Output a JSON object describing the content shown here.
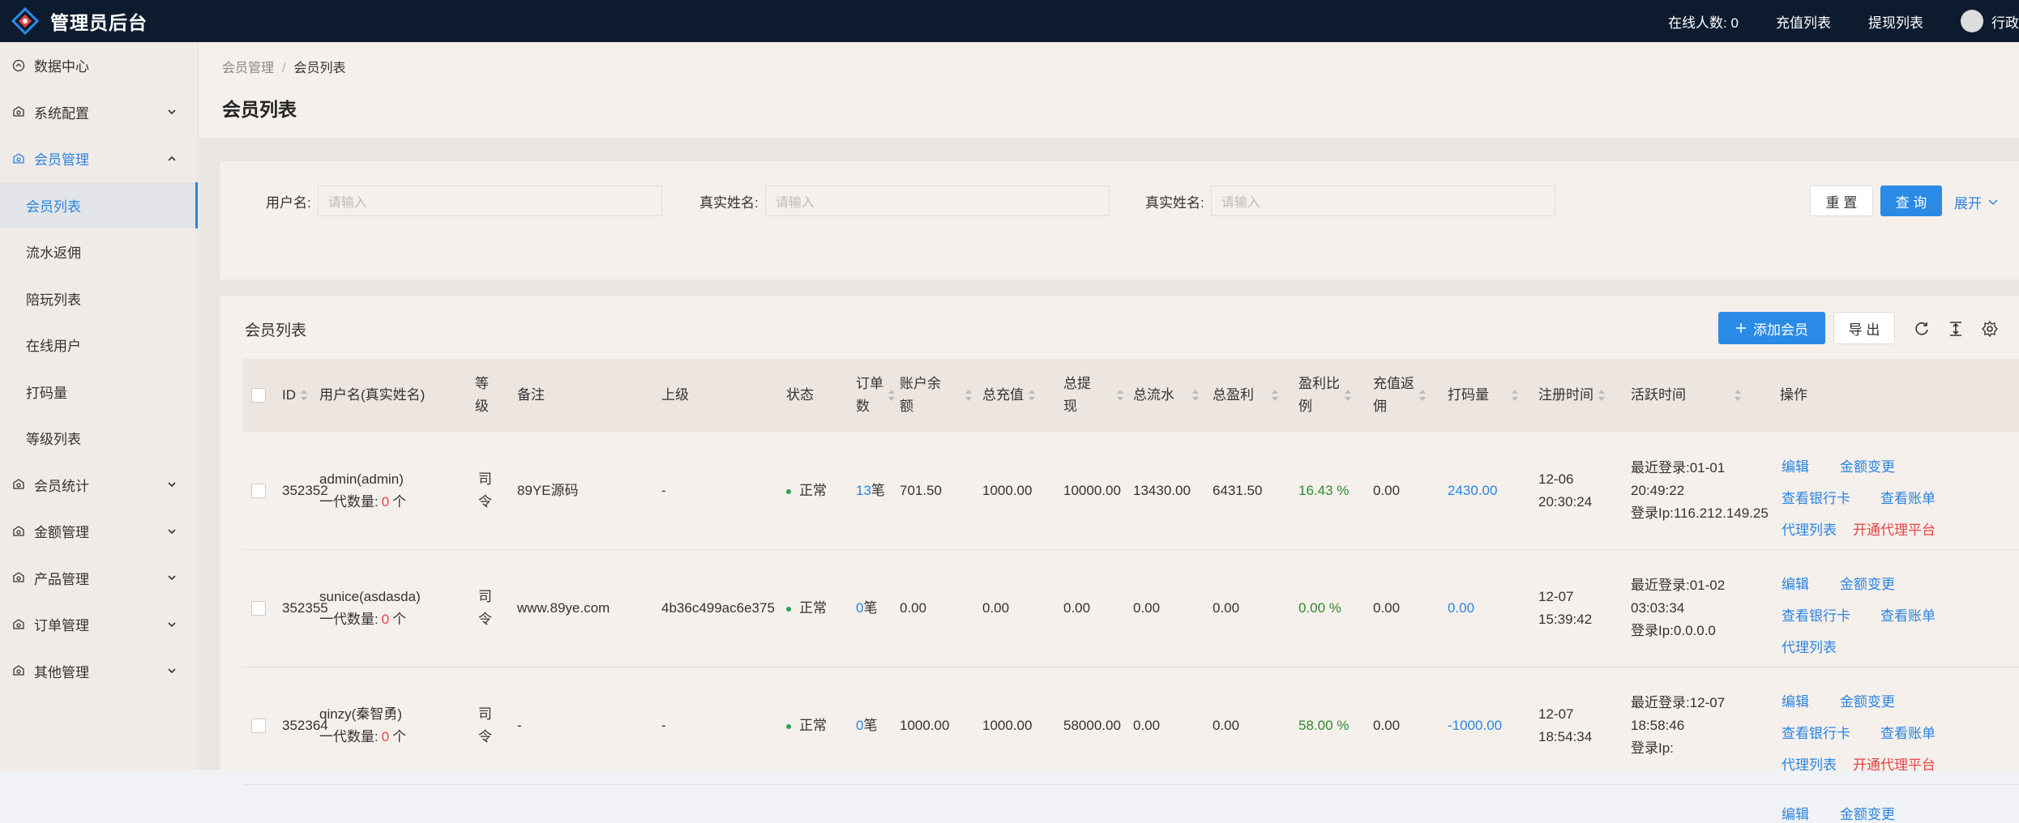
{
  "app": {
    "title": "管理员后台",
    "online_label": "在线人数:",
    "online_count": "0",
    "recharge_link": "充值列表",
    "withdraw_link": "提现列表",
    "user_name": "行政"
  },
  "sidebar": {
    "items": [
      {
        "label": "数据中心",
        "icon": "dashboard-icon",
        "has_children": false
      },
      {
        "label": "系统配置",
        "icon": "settings-icon",
        "has_children": true
      },
      {
        "label": "会员管理",
        "icon": "users-icon",
        "has_children": true,
        "expanded": true
      },
      {
        "label": "会员统计",
        "icon": "stats-icon",
        "has_children": true
      },
      {
        "label": "金额管理",
        "icon": "money-icon",
        "has_children": true
      },
      {
        "label": "产品管理",
        "icon": "product-icon",
        "has_children": true
      },
      {
        "label": "订单管理",
        "icon": "order-icon",
        "has_children": true
      },
      {
        "label": "其他管理",
        "icon": "other-icon",
        "has_children": true
      }
    ],
    "subitems": [
      "会员列表",
      "流水返佣",
      "陪玩列表",
      "在线用户",
      "打码量",
      "等级列表"
    ],
    "selected_subitem": "会员列表"
  },
  "breadcrumb": {
    "parent": "会员管理",
    "sep": "/",
    "current": "会员列表"
  },
  "page_title": "会员列表",
  "search": {
    "fields": [
      {
        "label": "用户名:",
        "placeholder": "请输入"
      },
      {
        "label": "真实姓名:",
        "placeholder": "请输入"
      },
      {
        "label": "真实姓名:",
        "placeholder": "请输入"
      }
    ],
    "reset": "重 置",
    "query": "查 询",
    "expand": "展开"
  },
  "table": {
    "title": "会员列表",
    "add_button": "添加会员",
    "export_button": "导 出",
    "columns": [
      "ID",
      "用户名(真实姓名)",
      "等级",
      "备注",
      "上级",
      "状态",
      "订单数",
      "账户余额",
      "总充值",
      "总提现",
      "总流水",
      "总盈利",
      "盈利比例",
      "充值返佣",
      "打码量",
      "注册时间",
      "活跃时间",
      "操作"
    ],
    "columns_display": {
      "level": [
        "等",
        "级"
      ],
      "orders": [
        "订单",
        "数"
      ],
      "balance": [
        "账户余",
        "额"
      ],
      "withdraw": [
        "总提",
        "现"
      ],
      "ratio": [
        "盈利比",
        "例"
      ],
      "rebate": [
        "充值返",
        "佣"
      ]
    },
    "rows": [
      {
        "id": "352352",
        "username": "admin(admin)",
        "sub_label": "一代数量:",
        "sub_count": "0",
        "sub_unit": "个",
        "level": [
          "司",
          "令"
        ],
        "remark": "89YE源码",
        "parent": "-",
        "status": "正常",
        "orders": "13",
        "orders_unit": "笔",
        "balance": "701.50",
        "recharge": "1000.00",
        "withdraw": "10000.00",
        "flow": "13430.00",
        "profit": "6431.50",
        "ratio": "16.43 %",
        "rebate": "0.00",
        "bet": "2430.00",
        "reg_date": "12-06",
        "reg_time": "20:30:24",
        "active_1": "最近登录:01-01",
        "active_2": "20:49:22",
        "active_3": "登录Ip:116.212.149.25",
        "ops": [
          "编辑",
          "金额变更",
          "查看银行卡",
          "查看账单",
          "代理列表",
          "开通代理平台"
        ]
      },
      {
        "id": "352355",
        "username": "sunice(asdasda)",
        "sub_label": "一代数量:",
        "sub_count": "0",
        "sub_unit": "个",
        "level": [
          "司",
          "令"
        ],
        "remark": "www.89ye.com",
        "parent": "4b36c499ac6e375",
        "status": "正常",
        "orders": "0",
        "orders_unit": "笔",
        "balance": "0.00",
        "recharge": "0.00",
        "withdraw": "0.00",
        "flow": "0.00",
        "profit": "0.00",
        "ratio": "0.00 %",
        "rebate": "0.00",
        "bet": "0.00",
        "reg_date": "12-07",
        "reg_time": "15:39:42",
        "active_1": "最近登录:01-02",
        "active_2": "03:03:34",
        "active_3": "登录Ip:0.0.0.0",
        "ops": [
          "编辑",
          "金额变更",
          "查看银行卡",
          "查看账单",
          "代理列表"
        ]
      },
      {
        "id": "352364",
        "username": "qinzy(秦智勇)",
        "sub_label": "一代数量:",
        "sub_count": "0",
        "sub_unit": "个",
        "level": [
          "司",
          "令"
        ],
        "remark": "-",
        "parent": "-",
        "status": "正常",
        "orders": "0",
        "orders_unit": "笔",
        "balance": "1000.00",
        "recharge": "1000.00",
        "withdraw": "58000.00",
        "flow": "0.00",
        "profit": "0.00",
        "ratio": "58.00 %",
        "rebate": "0.00",
        "bet": "-1000.00",
        "reg_date": "12-07",
        "reg_time": "18:54:34",
        "active_1": "最近登录:12-07",
        "active_2": "18:58:46",
        "active_3": "登录Ip:",
        "ops": [
          "编辑",
          "金额变更",
          "查看银行卡",
          "查看账单",
          "代理列表",
          "开通代理平台"
        ]
      }
    ],
    "partial_ops": [
      "编辑",
      "金额变更"
    ]
  },
  "colors": {
    "accent": "#2a8be6",
    "topbar": "#0d1b2e",
    "danger": "#e54545",
    "success": "#2da44e"
  }
}
